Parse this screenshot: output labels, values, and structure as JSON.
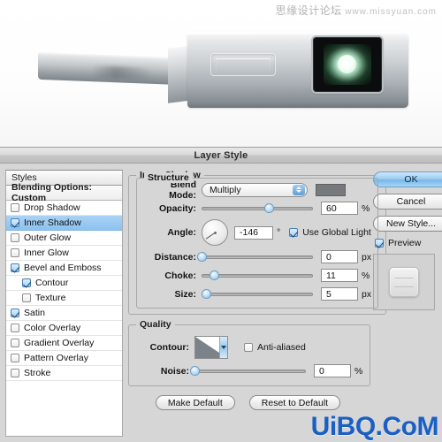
{
  "photo": {
    "watermark_cn": "思缘设计论坛",
    "watermark_url": "www.missyuan.com",
    "alt": "metallic device with glowing green led"
  },
  "dialog": {
    "title": "Layer Style"
  },
  "styles_panel": {
    "header": "Styles",
    "blending_options": "Blending Options: Custom",
    "items": [
      {
        "label": "Drop Shadow",
        "checked": false,
        "indent": false,
        "selected": false
      },
      {
        "label": "Inner Shadow",
        "checked": true,
        "indent": false,
        "selected": true
      },
      {
        "label": "Outer Glow",
        "checked": false,
        "indent": false,
        "selected": false
      },
      {
        "label": "Inner Glow",
        "checked": false,
        "indent": false,
        "selected": false
      },
      {
        "label": "Bevel and Emboss",
        "checked": true,
        "indent": false,
        "selected": false
      },
      {
        "label": "Contour",
        "checked": true,
        "indent": true,
        "selected": false
      },
      {
        "label": "Texture",
        "checked": false,
        "indent": true,
        "selected": false
      },
      {
        "label": "Satin",
        "checked": true,
        "indent": false,
        "selected": false
      },
      {
        "label": "Color Overlay",
        "checked": false,
        "indent": false,
        "selected": false
      },
      {
        "label": "Gradient Overlay",
        "checked": false,
        "indent": false,
        "selected": false
      },
      {
        "label": "Pattern Overlay",
        "checked": false,
        "indent": false,
        "selected": false
      },
      {
        "label": "Stroke",
        "checked": false,
        "indent": false,
        "selected": false
      }
    ]
  },
  "inner_shadow": {
    "group_title": "Inner Shadow",
    "structure_title": "Structure",
    "blend_mode": {
      "label": "Blend Mode:",
      "value": "Multiply",
      "color_swatch": "#77797c"
    },
    "opacity": {
      "label": "Opacity:",
      "value": "60",
      "unit": "%",
      "percent": 60
    },
    "angle": {
      "label": "Angle:",
      "value": "-146",
      "unit": "°",
      "degrees": -146,
      "use_global_light": {
        "label": "Use Global Light",
        "checked": true
      }
    },
    "distance": {
      "label": "Distance:",
      "value": "0",
      "unit": "px",
      "percent": 0
    },
    "choke": {
      "label": "Choke:",
      "value": "11",
      "unit": "%",
      "percent": 11
    },
    "size": {
      "label": "Size:",
      "value": "5",
      "unit": "px",
      "percent": 4
    },
    "quality": {
      "title": "Quality",
      "contour": {
        "label": "Contour:"
      },
      "anti_aliased": {
        "label": "Anti-aliased",
        "checked": false
      },
      "noise": {
        "label": "Noise:",
        "value": "0",
        "unit": "%",
        "percent": 0
      }
    },
    "make_default": "Make Default",
    "reset_to_default": "Reset to Default"
  },
  "actions": {
    "ok": "OK",
    "cancel": "Cancel",
    "new_style": "New Style...",
    "preview": {
      "label": "Preview",
      "checked": true
    }
  },
  "watermark_bottom": "UiBQ.CoM",
  "colors": {
    "selection_blue": "#8cc2ef",
    "checkbox_blue": "#14457c",
    "watermark_blue": "#1b5fc4",
    "dialog_gray": "#d6d6d6"
  }
}
